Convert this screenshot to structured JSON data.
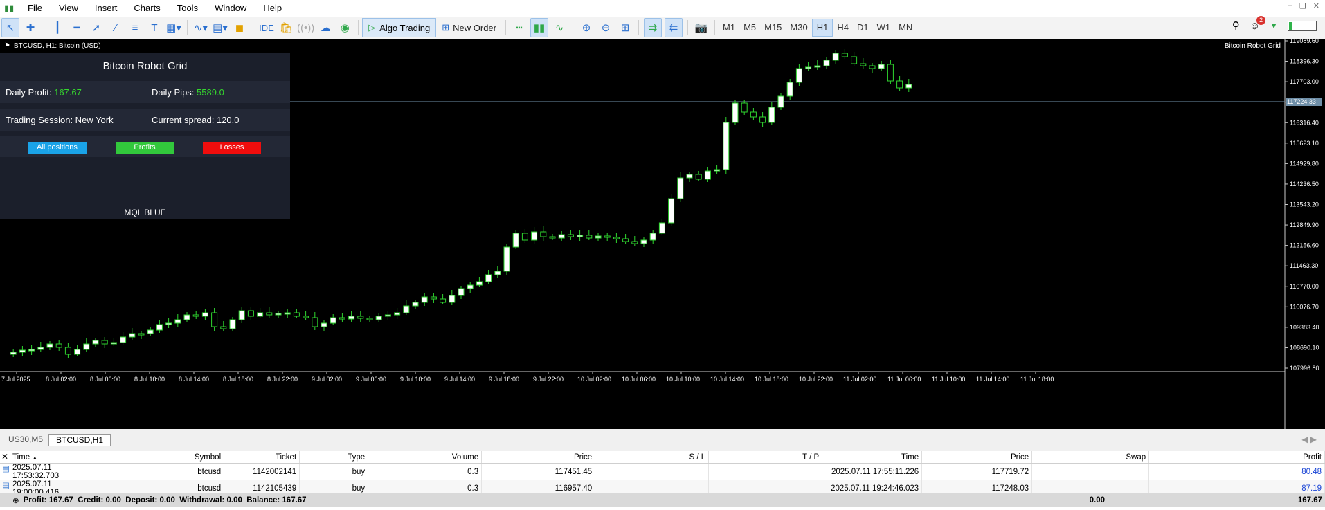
{
  "menu": {
    "items": [
      "File",
      "View",
      "Insert",
      "Charts",
      "Tools",
      "Window",
      "Help"
    ]
  },
  "toolbar": {
    "ide": "IDE",
    "algo_trading": "Algo Trading",
    "new_order": "New Order",
    "timeframes": [
      "M1",
      "M5",
      "M15",
      "M30",
      "H1",
      "H4",
      "D1",
      "W1",
      "MN"
    ],
    "active_timeframe": "H1",
    "notification_count": "2"
  },
  "chart": {
    "title": "BTCUSD, H1:  Bitcoin (USD)",
    "ea_name": "Bitcoin Robot Grid",
    "current_price_label": "117224.33",
    "price_labels": [
      "119089.60",
      "118396.30",
      "117703.00",
      "117009.70",
      "116316.40",
      "115623.10",
      "114929.80",
      "114236.50",
      "113543.20",
      "112849.90",
      "112156.60",
      "111463.30",
      "110770.00",
      "110076.70",
      "109383.40",
      "108690.10",
      "107996.80"
    ],
    "time_labels": [
      "7 Jul 2025",
      "8 Jul 02:00",
      "8 Jul 06:00",
      "8 Jul 10:00",
      "8 Jul 14:00",
      "8 Jul 18:00",
      "8 Jul 22:00",
      "9 Jul 02:00",
      "9 Jul 06:00",
      "9 Jul 10:00",
      "9 Jul 14:00",
      "9 Jul 18:00",
      "9 Jul 22:00",
      "10 Jul 02:00",
      "10 Jul 06:00",
      "10 Jul 10:00",
      "10 Jul 14:00",
      "10 Jul 18:00",
      "10 Jul 22:00",
      "11 Jul 02:00",
      "11 Jul 06:00",
      "11 Jul 10:00",
      "11 Jul 14:00",
      "11 Jul 18:00"
    ]
  },
  "panel": {
    "title": "Bitcoin Robot Grid",
    "daily_profit_label": "Daily Profit:",
    "daily_profit": "167.67",
    "daily_pips_label": "Daily Pips:",
    "daily_pips": "5589.0",
    "session_label": "Trading Session: New York",
    "spread_label": "Current spread: 120.0",
    "buttons": {
      "all": "All positions",
      "profits": "Profits",
      "losses": "Losses"
    },
    "footer": "MQL BLUE",
    "colors": {
      "all": "#1aa3e8",
      "profits": "#32c83c",
      "losses": "#f00d0d"
    }
  },
  "tabs": [
    "US30,M5",
    "BTCUSD,H1"
  ],
  "table": {
    "headers": [
      "Time",
      "Symbol",
      "Ticket",
      "Type",
      "Volume",
      "Price",
      "S / L",
      "T / P",
      "Time",
      "Price",
      "Swap",
      "Profit"
    ],
    "rows": [
      [
        "2025.07.11 17:53:32.703",
        "btcusd",
        "1142002141",
        "buy",
        "0.3",
        "117451.45",
        "",
        "",
        "2025.07.11 17:55:11.226",
        "117719.72",
        "",
        "80.48"
      ],
      [
        "2025.07.11 19:00:00.416",
        "btcusd",
        "1142105439",
        "buy",
        "0.3",
        "116957.40",
        "",
        "",
        "2025.07.11 19:24:46.023",
        "117248.03",
        "",
        "87.19"
      ]
    ]
  },
  "summary": {
    "text": "Profit: 167.67  Credit: 0.00  Deposit: 0.00  Withdrawal: 0.00  Balance: 167.67",
    "swap": "0.00",
    "profit": "167.67"
  }
}
